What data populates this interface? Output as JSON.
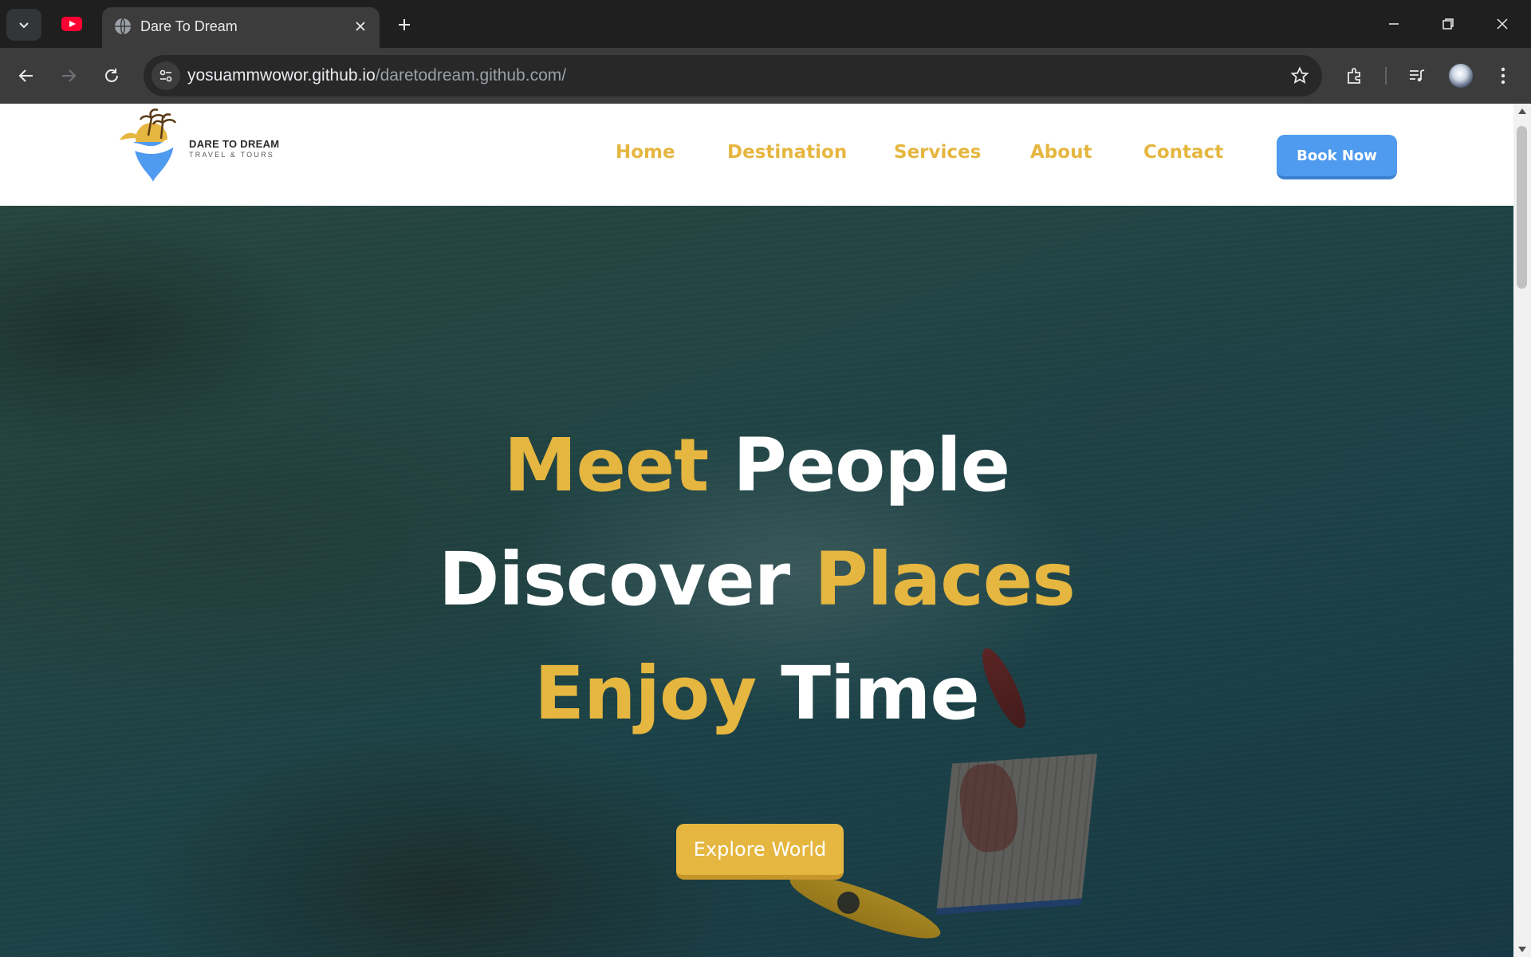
{
  "browser": {
    "tab_title": "Dare To Dream",
    "url_host": "yosuammwowor.github.io",
    "url_path": "/daretodream.github.com/",
    "icons": [
      "tab-search-icon",
      "youtube-icon",
      "globe-icon",
      "close-icon",
      "plus-icon",
      "minimize-icon",
      "restore-icon",
      "window-close-icon",
      "back-icon",
      "forward-icon",
      "reload-icon",
      "site-info-icon",
      "star-icon",
      "extensions-icon",
      "media-icon",
      "avatar",
      "kebab-menu-icon"
    ]
  },
  "site": {
    "logo": {
      "title": "DARE TO DREAM",
      "subtitle": "TRAVEL & TOURS"
    },
    "nav": [
      {
        "label": "Home"
      },
      {
        "label": "Destination"
      },
      {
        "label": "Services"
      },
      {
        "label": "About"
      },
      {
        "label": "Contact"
      }
    ],
    "book_button": "Book Now",
    "hero": {
      "line1": {
        "gold": "Meet",
        "white": "People"
      },
      "line2": {
        "white": "Discover",
        "gold": "Places"
      },
      "line3": {
        "gold": "Enjoy",
        "white": "Time"
      },
      "cta": "Explore World"
    },
    "colors": {
      "accent_gold": "#e5b640",
      "button_blue": "#4f9bef",
      "hero_water": "#2a5656"
    }
  }
}
